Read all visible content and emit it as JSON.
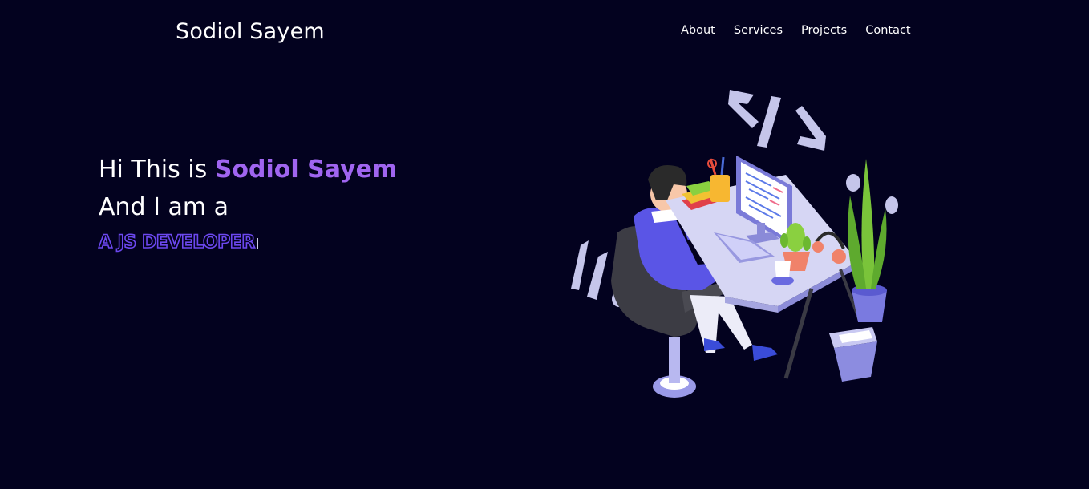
{
  "brand": {
    "name": "Sodiol Sayem"
  },
  "nav": {
    "items": [
      "About",
      "Services",
      "Projects",
      "Contact"
    ]
  },
  "hero": {
    "greeting": "Hi This is ",
    "name": "Sodiol Sayem",
    "line2": "And I am a",
    "role": "A JS DEVELOPER"
  },
  "colors": {
    "background": "#03021f",
    "accent": "#a065f0",
    "outline": "#6c48f0"
  },
  "illustration": {
    "icon": "developer-at-desk-illustration"
  }
}
